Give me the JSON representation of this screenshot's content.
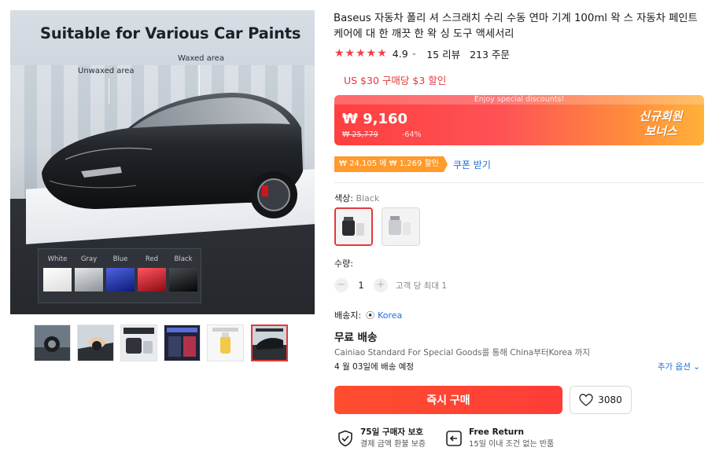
{
  "gallery": {
    "main_image": {
      "title": "Suitable for Various Car Paints",
      "label_unwaxed": "Unwaxed area",
      "label_waxed": "Waxed area",
      "swatches": [
        {
          "name": "White",
          "color": "#f2f2f2"
        },
        {
          "name": "Gray",
          "color": "#b9bcc0"
        },
        {
          "name": "Blue",
          "color": "#1a2fb0"
        },
        {
          "name": "Red",
          "color": "#d0151f"
        },
        {
          "name": "Black",
          "color": "#0c0c0e"
        }
      ]
    },
    "thumbnail_count": 6,
    "active_thumbnail": 6
  },
  "product": {
    "title": "Baseus 자동차 폴리 셔 스크래치 수리 수동 연마 기계 100ml 왁 스 자동차 페인트 케어에 대 한 깨끗 한 왁 싱 도구 액세서리",
    "stars": "★★★★★",
    "rating": "4.9",
    "rating_caret": "⌄",
    "reviews": "15 리뷰",
    "orders": "213 주문",
    "store_discount": "US $30 구매당 $3 할인"
  },
  "price_banner": {
    "top_text": "Enjoy special discounts!",
    "current_price": "₩ 9,160",
    "original_price": "₩ 25,779",
    "discount_percent": "-64%",
    "new_user_line1": "신규회원",
    "new_user_line2": "보너스",
    "gradient_start": "#ff3f3f",
    "gradient_end": "#ffb13a"
  },
  "coupon": {
    "chip_text": "₩ 24,105 에 ₩ 1,269 할인",
    "link_text": "쿠폰 받기"
  },
  "color": {
    "label": "색상: ",
    "value": "Black",
    "options": [
      "Black",
      "White"
    ],
    "selected_index": 0
  },
  "quantity": {
    "label": "수량:",
    "minus": "−",
    "value": "1",
    "plus": "+",
    "limit_text": "고객 당 최대 1"
  },
  "shipping": {
    "ship_to_label": "배송지:",
    "pin_icon": "⦿",
    "country": "Korea",
    "free_shipping": "무료 배송",
    "method": "Cainiao Standard For Special Goods를 통해 China부터Korea 까지",
    "date": "4 월 03일에 배송 예정",
    "more_options": "추가 옵션 ⌄"
  },
  "actions": {
    "buy_now": "즉시 구매",
    "wishlist_count": "3080",
    "accent_color": "#fe3d37"
  },
  "guarantees": [
    {
      "title": "75일 구매자 보호",
      "subtitle": "결제 금액 환불 보증",
      "icon": "shield-check-icon"
    },
    {
      "title": "Free Return",
      "subtitle": "15일 이내 조건 없는 반품",
      "icon": "return-arrow-icon"
    }
  ]
}
